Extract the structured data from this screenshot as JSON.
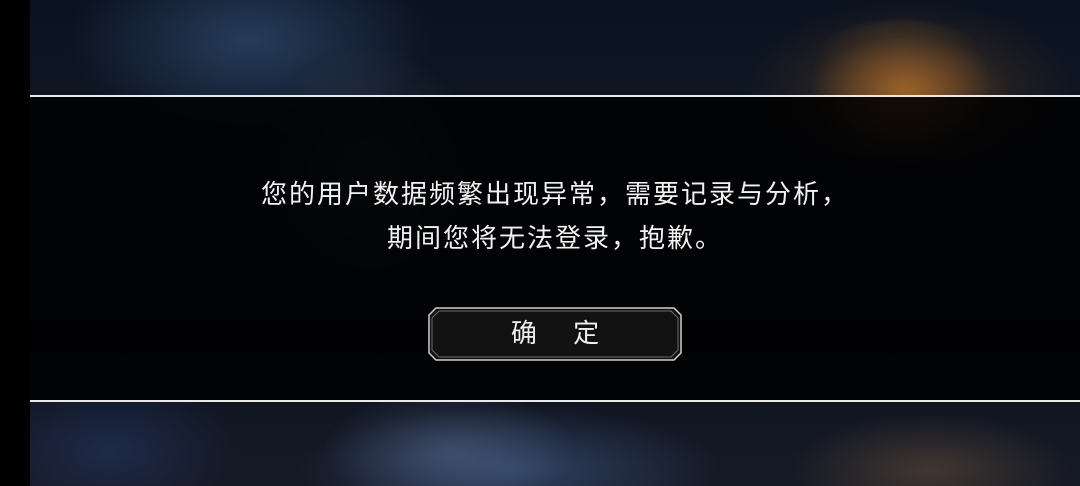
{
  "dialog": {
    "message_line1": "您的用户数据频繁出现异常，需要记录与分析，",
    "message_line2": "期间您将无法登录，抱歉。",
    "confirm_label": "确 定"
  },
  "colors": {
    "band": "#000000",
    "line": "#e9e9e9",
    "text": "#f2f2f2",
    "button_border": "#cfcfcf"
  }
}
